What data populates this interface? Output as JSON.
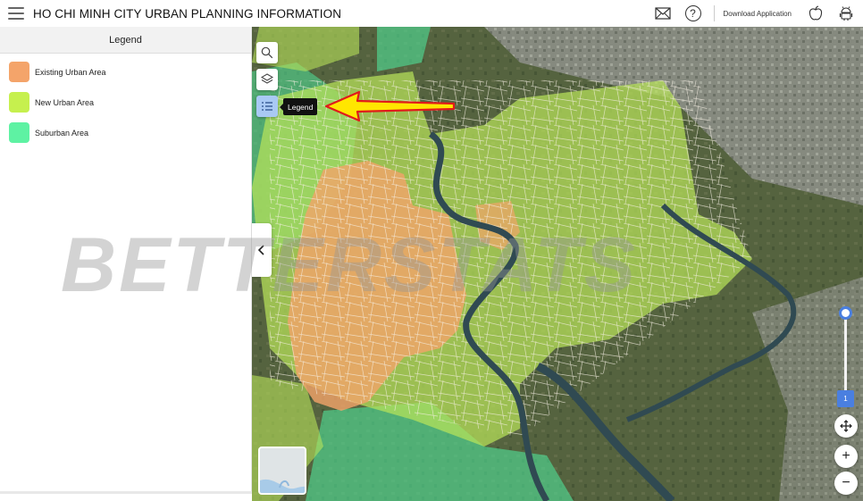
{
  "header": {
    "title": "HO CHI MINH CITY URBAN PLANNING INFORMATION",
    "help_symbol": "?",
    "download_label": "Download Application",
    "icons": [
      "menu-icon",
      "mail-icon",
      "help-icon",
      "apple-icon",
      "android-icon"
    ]
  },
  "sidebar": {
    "title": "Legend",
    "items": [
      {
        "label": "Existing Urban Area",
        "color": "#f4a46a"
      },
      {
        "label": "New Urban Area",
        "color": "#c6f04e"
      },
      {
        "label": "Suburban Area",
        "color": "#5ef2a3"
      }
    ],
    "collapse_symbol": "‹"
  },
  "map": {
    "tooltip": "Legend",
    "tools": [
      "search-icon",
      "layers-icon",
      "legend-list-icon"
    ],
    "zoom_value": "1",
    "zoom_in_symbol": "+",
    "zoom_out_symbol": "−",
    "overlay_colors": {
      "existing": "#f4a46a",
      "new": "#b8e35a",
      "suburban": "#4fe39a",
      "river": "#304a52"
    }
  },
  "watermark": {
    "text": "BETTERSTATS"
  }
}
